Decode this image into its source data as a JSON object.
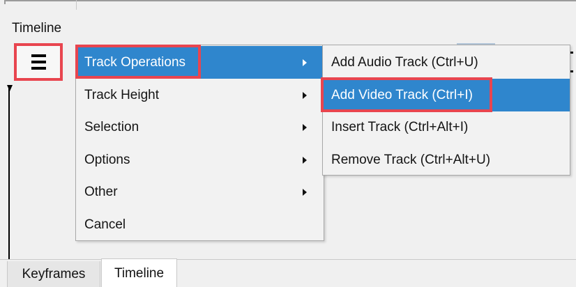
{
  "panel": {
    "title": "Timeline"
  },
  "menu": {
    "items": [
      {
        "label": "Track Operations",
        "has_submenu": true,
        "active": true
      },
      {
        "label": "Track Height",
        "has_submenu": true
      },
      {
        "label": "Selection",
        "has_submenu": true
      },
      {
        "label": "Options",
        "has_submenu": true
      },
      {
        "label": "Other",
        "has_submenu": true
      },
      {
        "label": "Cancel",
        "has_submenu": false
      }
    ]
  },
  "submenu": {
    "items": [
      {
        "label": "Add Audio Track (Ctrl+U)"
      },
      {
        "label": "Add Video Track (Ctrl+I)",
        "active": true
      },
      {
        "label": "Insert Track (Ctrl+Alt+I)"
      },
      {
        "label": "Remove Track (Ctrl+Alt+U)"
      }
    ]
  },
  "tabs": [
    {
      "label": "Keyframes",
      "selected": false
    },
    {
      "label": "Timeline",
      "selected": true
    }
  ],
  "icons": {
    "menu": "hamburger-menu-icon",
    "submenu_arrow": "chevron-right-icon"
  },
  "colors": {
    "highlight": "#2f86cd",
    "annotation": "#e8454f"
  }
}
